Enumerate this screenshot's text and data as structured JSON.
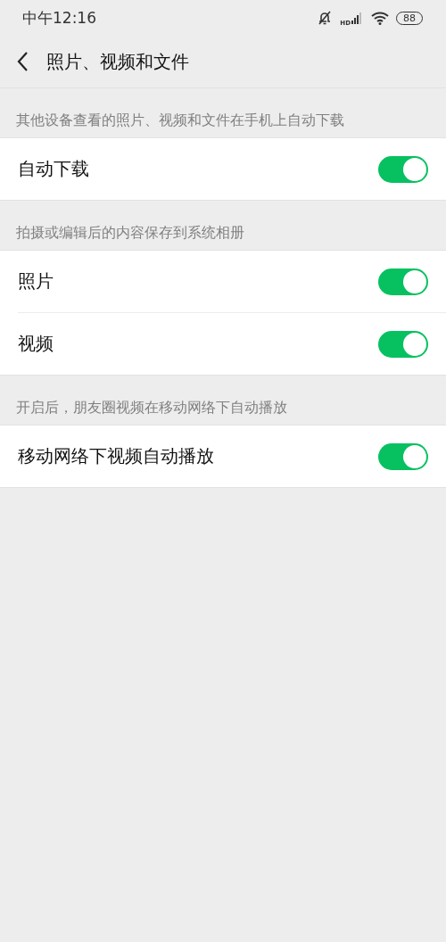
{
  "status_bar": {
    "time": "中午12:16",
    "network": "HD",
    "battery": "88"
  },
  "header": {
    "title": "照片、视频和文件"
  },
  "sections": [
    {
      "caption": "其他设备查看的照片、视频和文件在手机上自动下载",
      "items": [
        {
          "label": "自动下载",
          "on": true
        }
      ]
    },
    {
      "caption": "拍摄或编辑后的内容保存到系统相册",
      "items": [
        {
          "label": "照片",
          "on": true
        },
        {
          "label": "视频",
          "on": true
        }
      ]
    },
    {
      "caption": "开启后，朋友圈视频在移动网络下自动播放",
      "items": [
        {
          "label": "移动网络下视频自动播放",
          "on": true
        }
      ]
    }
  ]
}
